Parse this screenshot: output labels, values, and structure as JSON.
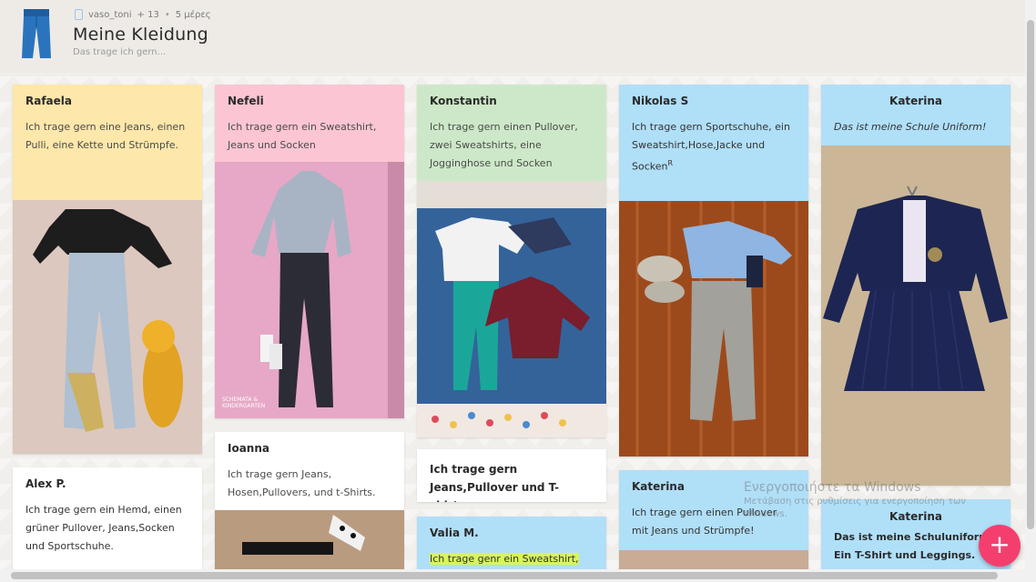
{
  "header": {
    "owner": "vaso_toni",
    "plus_count": "+ 13",
    "age": "5 μέρες",
    "title": "Meine Kleidung",
    "subtitle": "Das trage ich gern..."
  },
  "posts": [
    {
      "author": "Rafaela",
      "body": "Ich trage gern eine Jeans, einen Pulli, eine Kette und Strümpfe."
    },
    {
      "author": "Alex P.",
      "body": "Ich trage gern ein Hemd, einen grüner Pullover, Jeans,Socken und Sportschuhe."
    },
    {
      "author": "Nefeli",
      "body": "Ich trage gern ein Sweatshirt, Jeans und Socken"
    },
    {
      "author": "Ioanna",
      "body": "Ich trage gern Jeans, Hosen,Pullovers, und t-Shirts."
    },
    {
      "author": "Konstantin",
      "body": "Ich trage gern einen Pullover, zwei Sweatshirts, eine Jogginghose und Socken"
    },
    {
      "author": "",
      "body": "Ich trage gern Jeans,Pullover und T-shirts"
    },
    {
      "author": "Valia M.",
      "body": "Ich trage genr ein Sweatshirt,"
    },
    {
      "author": "Nikolas S",
      "body": "Ich trage gern Sportschuhe, ein Sweatshirt,Hose,Jacke und Socken",
      "sup": "R"
    },
    {
      "author": "Katerina",
      "body": "Ich trage gern einen Pullover mit Jeans und  Strümpfe!"
    },
    {
      "author": "Katerina",
      "body": "Das ist meine Schule Uniform!"
    },
    {
      "author": "Katerina",
      "body": "Das ist meine Schuluniform. Ein T-Shirt und Leggings."
    }
  ],
  "photo_caption": "SCHEMATA &\nKINDERGARTEN",
  "add_button": "+",
  "watermark": {
    "line1": "Ενεργοποιήστε τα Windows",
    "line2": "Μετάβαση στις ρυθμίσεις για ενεργοποίηση των",
    "line3": "Windows."
  },
  "colors": {
    "yellow": "#fde7aa",
    "pink": "#fbc5d3",
    "green": "#cde8c8",
    "blue": "#b0dff8",
    "fab": "#f43f6e"
  },
  "icons": {
    "logo": "jeans-icon",
    "owner": "person-icon",
    "add": "plus-icon"
  }
}
